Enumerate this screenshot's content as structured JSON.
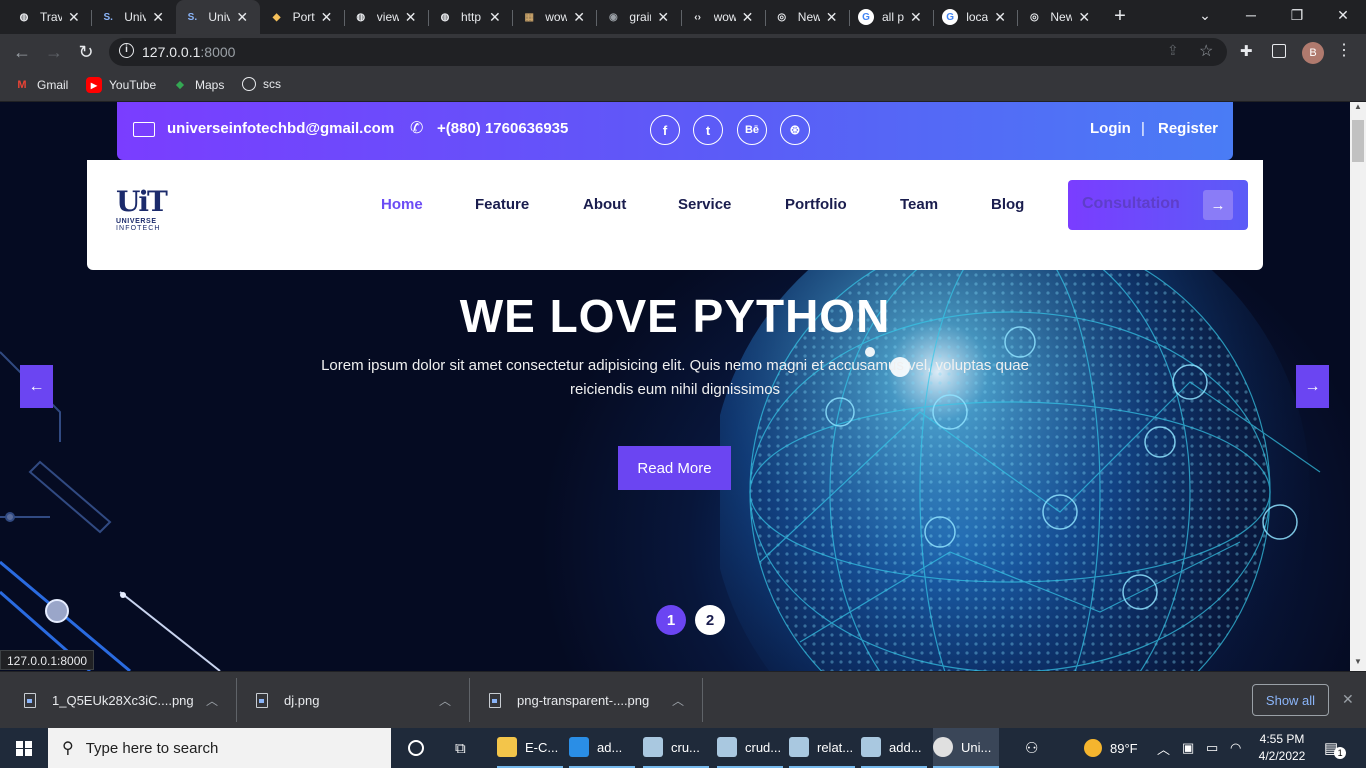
{
  "browser": {
    "tabs": [
      {
        "title": "Travel",
        "icon": "globe-icon",
        "active": false
      },
      {
        "title": "Universe",
        "icon": "s-logo-icon",
        "active": false
      },
      {
        "title": "Universe",
        "icon": "s-logo-icon",
        "active": true
      },
      {
        "title": "Portfolio",
        "icon": "portfolio-icon",
        "active": false
      },
      {
        "title": "view",
        "icon": "globe-icon",
        "active": false
      },
      {
        "title": "http",
        "icon": "globe-icon",
        "active": false
      },
      {
        "title": "wow",
        "icon": "image-icon",
        "active": false
      },
      {
        "title": "grain",
        "icon": "github-icon",
        "active": false
      },
      {
        "title": "wow",
        "icon": "code-icon",
        "active": false
      },
      {
        "title": "New",
        "icon": "chrome-icon",
        "active": false
      },
      {
        "title": "all p",
        "icon": "google-icon",
        "active": false
      },
      {
        "title": "local",
        "icon": "google-icon",
        "active": false
      },
      {
        "title": "New",
        "icon": "chrome-icon",
        "active": false
      }
    ],
    "new_tab_label": "+",
    "url_host": "127.0.0.1",
    "url_port": ":8000",
    "profile_initial": "B",
    "bookmarks": [
      {
        "label": "Gmail",
        "icon": "gmail-icon"
      },
      {
        "label": "YouTube",
        "icon": "youtube-icon"
      },
      {
        "label": "Maps",
        "icon": "maps-icon"
      },
      {
        "label": "scs",
        "icon": "globe-icon"
      }
    ],
    "status_url": "127.0.0.1:8000"
  },
  "site": {
    "topbar": {
      "email": "universeinfotechbd@gmail.com",
      "phone": "+(880) 1760636935",
      "social": [
        "f",
        "t",
        "Bē",
        "⊛"
      ],
      "login": "Login",
      "separator": "|",
      "register": "Register"
    },
    "logo": {
      "mark": "UiT",
      "line1": "UNIVERSE",
      "line2": "INFOTECH"
    },
    "nav": [
      "Home",
      "Feature",
      "About",
      "Service",
      "Portfolio",
      "Team",
      "Blog"
    ],
    "cta": "Consultation",
    "hero": {
      "title": "WE LOVE PYTHON",
      "description": "Lorem ipsum dolor sit amet consectetur adipisicing elit. Quis nemo magni et accusamus vel, voluptas quae reiciendis eum nihil dignissimos",
      "button": "Read More",
      "pages": [
        "1",
        "2"
      ]
    }
  },
  "downloads": {
    "items": [
      "1_Q5EUk28Xc3iC....png",
      "dj.png",
      "png-transparent-....png"
    ],
    "show_all": "Show all"
  },
  "taskbar": {
    "search_placeholder": "Type here to search",
    "apps": [
      {
        "label": "E-C...",
        "icon": "folder-icon"
      },
      {
        "label": "ad...",
        "icon": "vscode-icon"
      },
      {
        "label": "cru...",
        "icon": "sql-icon"
      },
      {
        "label": "crud...",
        "icon": "sql-icon"
      },
      {
        "label": "relat...",
        "icon": "sql-icon"
      },
      {
        "label": "add...",
        "icon": "sql-icon"
      },
      {
        "label": "Uni...",
        "icon": "chrome-icon"
      }
    ],
    "weather": "89°F",
    "time": "4:55 PM",
    "date": "4/2/2022",
    "notifications": "1"
  }
}
